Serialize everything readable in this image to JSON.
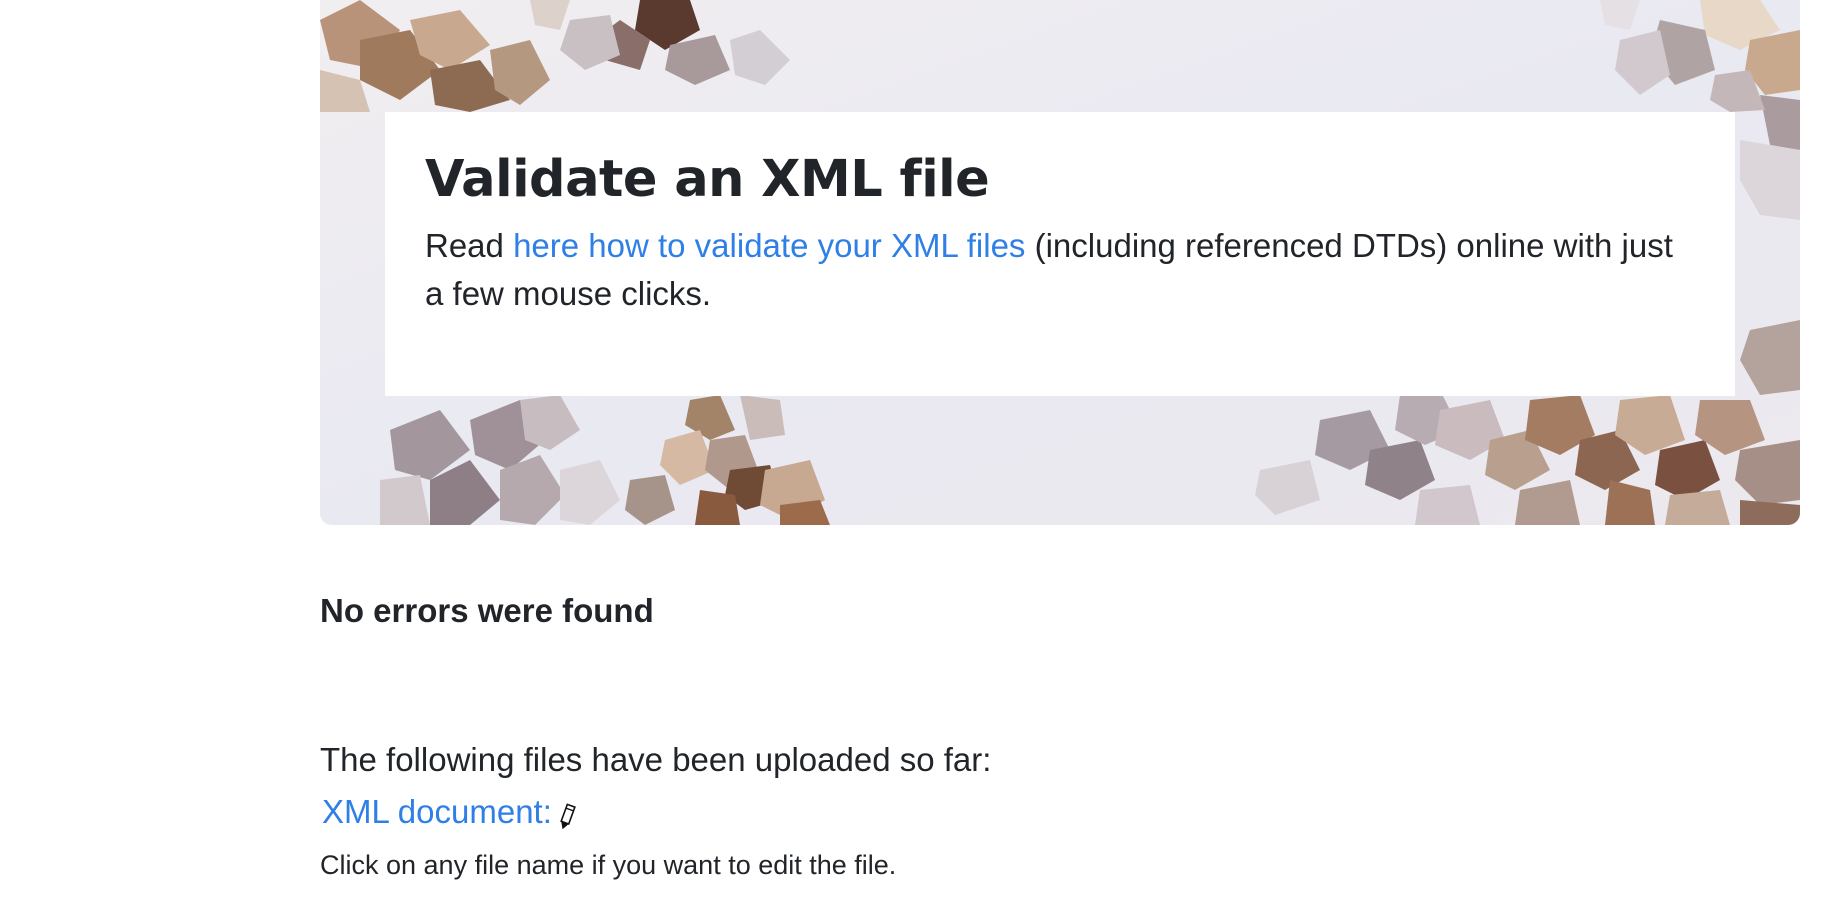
{
  "hero": {
    "title": "Validate an XML file",
    "text_before": "Read ",
    "link_label": "here how to validate your XML files",
    "text_after": " (including referenced DTDs) online with just a few mouse clicks."
  },
  "result": {
    "message": "No errors were found"
  },
  "files": {
    "heading": "The following files have been uploaded so far:",
    "items": [
      {
        "label": "XML document:",
        "icon": "pencil-icon"
      }
    ],
    "hint": "Click on any file name if you want to edit the file."
  },
  "colors": {
    "link": "#2f7fe6",
    "text": "#212529"
  }
}
